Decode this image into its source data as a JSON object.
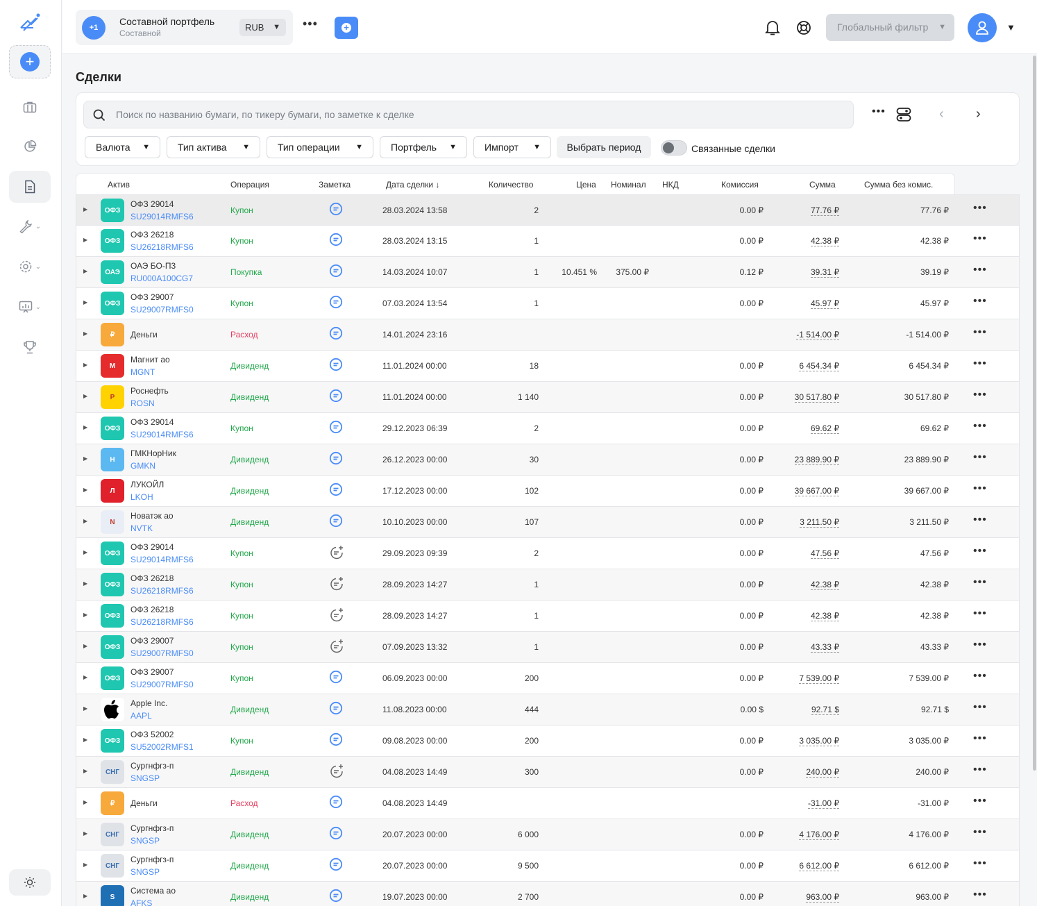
{
  "app": {
    "title": "Сделки"
  },
  "colors": {
    "accent": "#4a8cf7",
    "green": "#22a84a",
    "red": "#e53f5f"
  },
  "sidebar": {
    "items": [
      {
        "icon": "briefcase-icon"
      },
      {
        "icon": "pie-chart-icon"
      },
      {
        "icon": "document-icon",
        "active": true
      },
      {
        "icon": "wrench-icon"
      },
      {
        "icon": "gear-icon"
      },
      {
        "icon": "chart-board-icon"
      },
      {
        "icon": "trophy-icon"
      }
    ]
  },
  "topbar": {
    "portfolio_badge": "+1",
    "portfolio_name": "Составной портфель",
    "portfolio_type": "Составной",
    "currency": "RUB",
    "global_filter": "Глобальный фильтр"
  },
  "filters": {
    "search_placeholder": "Поиск по названию бумаги, по тикеру бумаги, по заметке к сделке",
    "currency": "Валюта",
    "asset_type": "Тип актива",
    "operation_type": "Тип операции",
    "portfolio": "Портфель",
    "import": "Импорт",
    "period": "Выбрать период",
    "linked": "Связанные сделки"
  },
  "table": {
    "headers": {
      "asset": "Актив",
      "operation": "Операция",
      "note": "Заметка",
      "date": "Дата сделки",
      "qty": "Количество",
      "price": "Цена",
      "nominal": "Номинал",
      "nkd": "НКД",
      "commission": "Комиссия",
      "sum": "Сумма",
      "sum_no_comm": "Сумма без комис."
    },
    "rows": [
      {
        "logo": "ОФЗ",
        "logo_bg": "#1fc7b0",
        "name": "ОФЗ 29014",
        "ticker": "SU29014RMFS6",
        "op": "Купон",
        "op_color": "green",
        "note": "note",
        "date": "28.03.2024 13:58",
        "qty": "2",
        "price": "",
        "nominal": "",
        "comm": "0.00 ₽",
        "sum": "77.76 ₽",
        "sum_nc": "77.76 ₽"
      },
      {
        "logo": "ОФЗ",
        "logo_bg": "#1fc7b0",
        "name": "ОФЗ 26218",
        "ticker": "SU26218RMFS6",
        "op": "Купон",
        "op_color": "green",
        "note": "note",
        "date": "28.03.2024 13:15",
        "qty": "1",
        "price": "",
        "nominal": "",
        "comm": "0.00 ₽",
        "sum": "42.38 ₽",
        "sum_nc": "42.38 ₽"
      },
      {
        "logo": "ОАЭ",
        "logo_bg": "#1fc7b0",
        "name": "ОАЭ БО-П3",
        "ticker": "RU000A100CG7",
        "op": "Покупка",
        "op_color": "green",
        "note": "note",
        "date": "14.03.2024 10:07",
        "qty": "1",
        "price": "10.451 %",
        "nominal": "375.00 ₽",
        "comm": "0.12 ₽",
        "sum": "39.31 ₽",
        "sum_nc": "39.19 ₽"
      },
      {
        "logo": "ОФЗ",
        "logo_bg": "#1fc7b0",
        "name": "ОФЗ 29007",
        "ticker": "SU29007RMFS0",
        "op": "Купон",
        "op_color": "green",
        "note": "note",
        "date": "07.03.2024 13:54",
        "qty": "1",
        "price": "",
        "nominal": "",
        "comm": "0.00 ₽",
        "sum": "45.97 ₽",
        "sum_nc": "45.97 ₽"
      },
      {
        "logo": "₽",
        "logo_bg": "#f7a93b",
        "name": "Деньги",
        "ticker": "",
        "op": "Расход",
        "op_color": "red",
        "note": "note",
        "date": "14.01.2024 23:16",
        "qty": "",
        "price": "",
        "nominal": "",
        "comm": "",
        "sum": "-1 514.00 ₽",
        "sum_nc": "-1 514.00 ₽"
      },
      {
        "logo": "М",
        "logo_bg": "#e52b2b",
        "name": "Магнит ао",
        "ticker": "MGNT",
        "op": "Дивиденд",
        "op_color": "green",
        "note": "note",
        "date": "11.01.2024 00:00",
        "qty": "18",
        "price": "",
        "nominal": "",
        "comm": "0.00 ₽",
        "sum": "6 454.34 ₽",
        "sum_nc": "6 454.34 ₽"
      },
      {
        "logo": "Р",
        "logo_bg": "#ffd200",
        "name": "Роснефть",
        "ticker": "ROSN",
        "op": "Дивиденд",
        "op_color": "green",
        "note": "note",
        "date": "11.01.2024 00:00",
        "qty": "1 140",
        "price": "",
        "nominal": "",
        "comm": "0.00 ₽",
        "sum": "30 517.80 ₽",
        "sum_nc": "30 517.80 ₽"
      },
      {
        "logo": "ОФЗ",
        "logo_bg": "#1fc7b0",
        "name": "ОФЗ 29014",
        "ticker": "SU29014RMFS6",
        "op": "Купон",
        "op_color": "green",
        "note": "note",
        "date": "29.12.2023 06:39",
        "qty": "2",
        "price": "",
        "nominal": "",
        "comm": "0.00 ₽",
        "sum": "69.62 ₽",
        "sum_nc": "69.62 ₽"
      },
      {
        "logo": "Н",
        "logo_bg": "#5cb8f0",
        "name": "ГМКНорНик",
        "ticker": "GMKN",
        "op": "Дивиденд",
        "op_color": "green",
        "note": "note",
        "date": "26.12.2023 00:00",
        "qty": "30",
        "price": "",
        "nominal": "",
        "comm": "0.00 ₽",
        "sum": "23 889.90 ₽",
        "sum_nc": "23 889.90 ₽"
      },
      {
        "logo": "Л",
        "logo_bg": "#e0202a",
        "name": "ЛУКОЙЛ",
        "ticker": "LKOH",
        "op": "Дивиденд",
        "op_color": "green",
        "note": "note",
        "date": "17.12.2023 00:00",
        "qty": "102",
        "price": "",
        "nominal": "",
        "comm": "0.00 ₽",
        "sum": "39 667.00 ₽",
        "sum_nc": "39 667.00 ₽"
      },
      {
        "logo": "N",
        "logo_bg": "#e9eef6",
        "name": "Новатэк ао",
        "ticker": "NVTK",
        "op": "Дивиденд",
        "op_color": "green",
        "note": "note",
        "date": "10.10.2023 00:00",
        "qty": "107",
        "price": "",
        "nominal": "",
        "comm": "0.00 ₽",
        "sum": "3 211.50 ₽",
        "sum_nc": "3 211.50 ₽"
      },
      {
        "logo": "ОФЗ",
        "logo_bg": "#1fc7b0",
        "name": "ОФЗ 29014",
        "ticker": "SU29014RMFS6",
        "op": "Купон",
        "op_color": "green",
        "note": "add",
        "date": "29.09.2023 09:39",
        "qty": "2",
        "price": "",
        "nominal": "",
        "comm": "0.00 ₽",
        "sum": "47.56 ₽",
        "sum_nc": "47.56 ₽"
      },
      {
        "logo": "ОФЗ",
        "logo_bg": "#1fc7b0",
        "name": "ОФЗ 26218",
        "ticker": "SU26218RMFS6",
        "op": "Купон",
        "op_color": "green",
        "note": "add",
        "date": "28.09.2023 14:27",
        "qty": "1",
        "price": "",
        "nominal": "",
        "comm": "0.00 ₽",
        "sum": "42.38 ₽",
        "sum_nc": "42.38 ₽"
      },
      {
        "logo": "ОФЗ",
        "logo_bg": "#1fc7b0",
        "name": "ОФЗ 26218",
        "ticker": "SU26218RMFS6",
        "op": "Купон",
        "op_color": "green",
        "note": "add",
        "date": "28.09.2023 14:27",
        "qty": "1",
        "price": "",
        "nominal": "",
        "comm": "0.00 ₽",
        "sum": "42.38 ₽",
        "sum_nc": "42.38 ₽"
      },
      {
        "logo": "ОФЗ",
        "logo_bg": "#1fc7b0",
        "name": "ОФЗ 29007",
        "ticker": "SU29007RMFS0",
        "op": "Купон",
        "op_color": "green",
        "note": "add",
        "date": "07.09.2023 13:32",
        "qty": "1",
        "price": "",
        "nominal": "",
        "comm": "0.00 ₽",
        "sum": "43.33 ₽",
        "sum_nc": "43.33 ₽"
      },
      {
        "logo": "ОФЗ",
        "logo_bg": "#1fc7b0",
        "name": "ОФЗ 29007",
        "ticker": "SU29007RMFS0",
        "op": "Купон",
        "op_color": "green",
        "note": "note",
        "date": "06.09.2023 00:00",
        "qty": "200",
        "price": "",
        "nominal": "",
        "comm": "0.00 ₽",
        "sum": "7 539.00 ₽",
        "sum_nc": "7 539.00 ₽"
      },
      {
        "logo": "",
        "logo_bg": "#ffffff",
        "name": "Apple Inc.",
        "ticker": "AAPL",
        "op": "Дивиденд",
        "op_color": "green",
        "note": "note",
        "date": "11.08.2023 00:00",
        "qty": "444",
        "price": "",
        "nominal": "",
        "comm": "0.00 $",
        "sum": "92.71 $",
        "sum_nc": "92.71 $"
      },
      {
        "logo": "ОФЗ",
        "logo_bg": "#1fc7b0",
        "name": "ОФЗ 52002",
        "ticker": "SU52002RMFS1",
        "op": "Купон",
        "op_color": "green",
        "note": "note",
        "date": "09.08.2023 00:00",
        "qty": "200",
        "price": "",
        "nominal": "",
        "comm": "0.00 ₽",
        "sum": "3 035.00 ₽",
        "sum_nc": "3 035.00 ₽"
      },
      {
        "logo": "СНГ",
        "logo_bg": "#dfe3e8",
        "name": "Сургнфгз-п",
        "ticker": "SNGSP",
        "op": "Дивиденд",
        "op_color": "green",
        "note": "add",
        "date": "04.08.2023 14:49",
        "qty": "300",
        "price": "",
        "nominal": "",
        "comm": "0.00 ₽",
        "sum": "240.00 ₽",
        "sum_nc": "240.00 ₽"
      },
      {
        "logo": "₽",
        "logo_bg": "#f7a93b",
        "name": "Деньги",
        "ticker": "",
        "op": "Расход",
        "op_color": "red",
        "note": "note",
        "date": "04.08.2023 14:49",
        "qty": "",
        "price": "",
        "nominal": "",
        "comm": "",
        "sum": "-31.00 ₽",
        "sum_nc": "-31.00 ₽"
      },
      {
        "logo": "СНГ",
        "logo_bg": "#dfe3e8",
        "name": "Сургнфгз-п",
        "ticker": "SNGSP",
        "op": "Дивиденд",
        "op_color": "green",
        "note": "note",
        "date": "20.07.2023 00:00",
        "qty": "6 000",
        "price": "",
        "nominal": "",
        "comm": "0.00 ₽",
        "sum": "4 176.00 ₽",
        "sum_nc": "4 176.00 ₽"
      },
      {
        "logo": "СНГ",
        "logo_bg": "#dfe3e8",
        "name": "Сургнфгз-п",
        "ticker": "SNGSP",
        "op": "Дивиденд",
        "op_color": "green",
        "note": "note",
        "date": "20.07.2023 00:00",
        "qty": "9 500",
        "price": "",
        "nominal": "",
        "comm": "0.00 ₽",
        "sum": "6 612.00 ₽",
        "sum_nc": "6 612.00 ₽"
      },
      {
        "logo": "S",
        "logo_bg": "#1f6fb5",
        "name": "Система ао",
        "ticker": "AFKS",
        "op": "Дивиденд",
        "op_color": "green",
        "note": "note",
        "date": "19.07.2023 00:00",
        "qty": "2 700",
        "price": "",
        "nominal": "",
        "comm": "0.00 ₽",
        "sum": "963.00 ₽",
        "sum_nc": "963.00 ₽"
      }
    ]
  }
}
